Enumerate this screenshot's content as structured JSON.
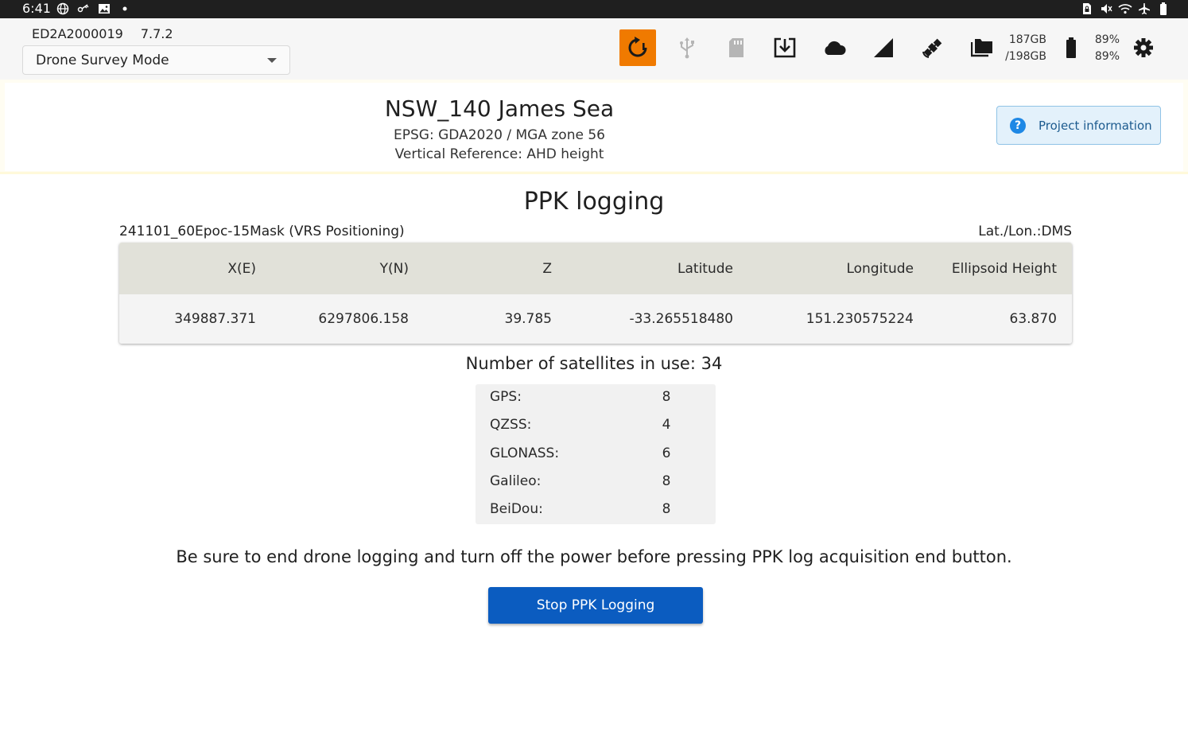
{
  "status_bar": {
    "time": "6:41",
    "left_icons": [
      "globe-icon",
      "key-icon",
      "image-icon",
      "dot-icon"
    ],
    "right_icons": [
      "sim-lock-icon",
      "mute-icon",
      "wifi-icon",
      "airplane-icon",
      "battery-icon"
    ]
  },
  "header": {
    "device_id": "ED2A2000019",
    "version": "7.7.2",
    "mode": "Drone Survey Mode",
    "storage_used": "187GB",
    "storage_total": "/198GB",
    "battery_1": "89%",
    "battery_2": "89%",
    "accent_color": "#f07a00",
    "icons": [
      "alert-refresh-icon",
      "usb-icon",
      "sd-card-icon",
      "download-icon",
      "cloud-icon",
      "signal-icon",
      "satellite-icon",
      "folders-icon",
      "battery-icon",
      "settings-icon"
    ]
  },
  "project": {
    "name": "NSW_140 James Sea",
    "epsg": "EPSG: GDA2020 / MGA zone 56",
    "vertical_reference": "Vertical Reference: AHD height",
    "info_button": "Project information"
  },
  "ppk": {
    "title": "PPK logging",
    "session": "241101_60Epoc-15Mask (VRS Positioning)",
    "coord_format": "Lat./Lon.:DMS",
    "columns": [
      "X(E)",
      "Y(N)",
      "Z",
      "Latitude",
      "Longitude",
      "Ellipsoid Height"
    ],
    "values": [
      "349887.371",
      "6297806.158",
      "39.785",
      "-33.265518480",
      "151.230575224",
      "63.870"
    ],
    "satellites_label": "Number of satellites in use: 34",
    "satellites": [
      {
        "name": "GPS:",
        "count": "8"
      },
      {
        "name": "QZSS:",
        "count": "4"
      },
      {
        "name": "GLONASS:",
        "count": "6"
      },
      {
        "name": "Galileo:",
        "count": "8"
      },
      {
        "name": "BeiDou:",
        "count": "8"
      }
    ],
    "warning": "Be sure to end drone logging and turn off the power before pressing PPK log acquisition end button.",
    "stop_button": "Stop PPK Logging",
    "button_color": "#0b5cc0"
  }
}
